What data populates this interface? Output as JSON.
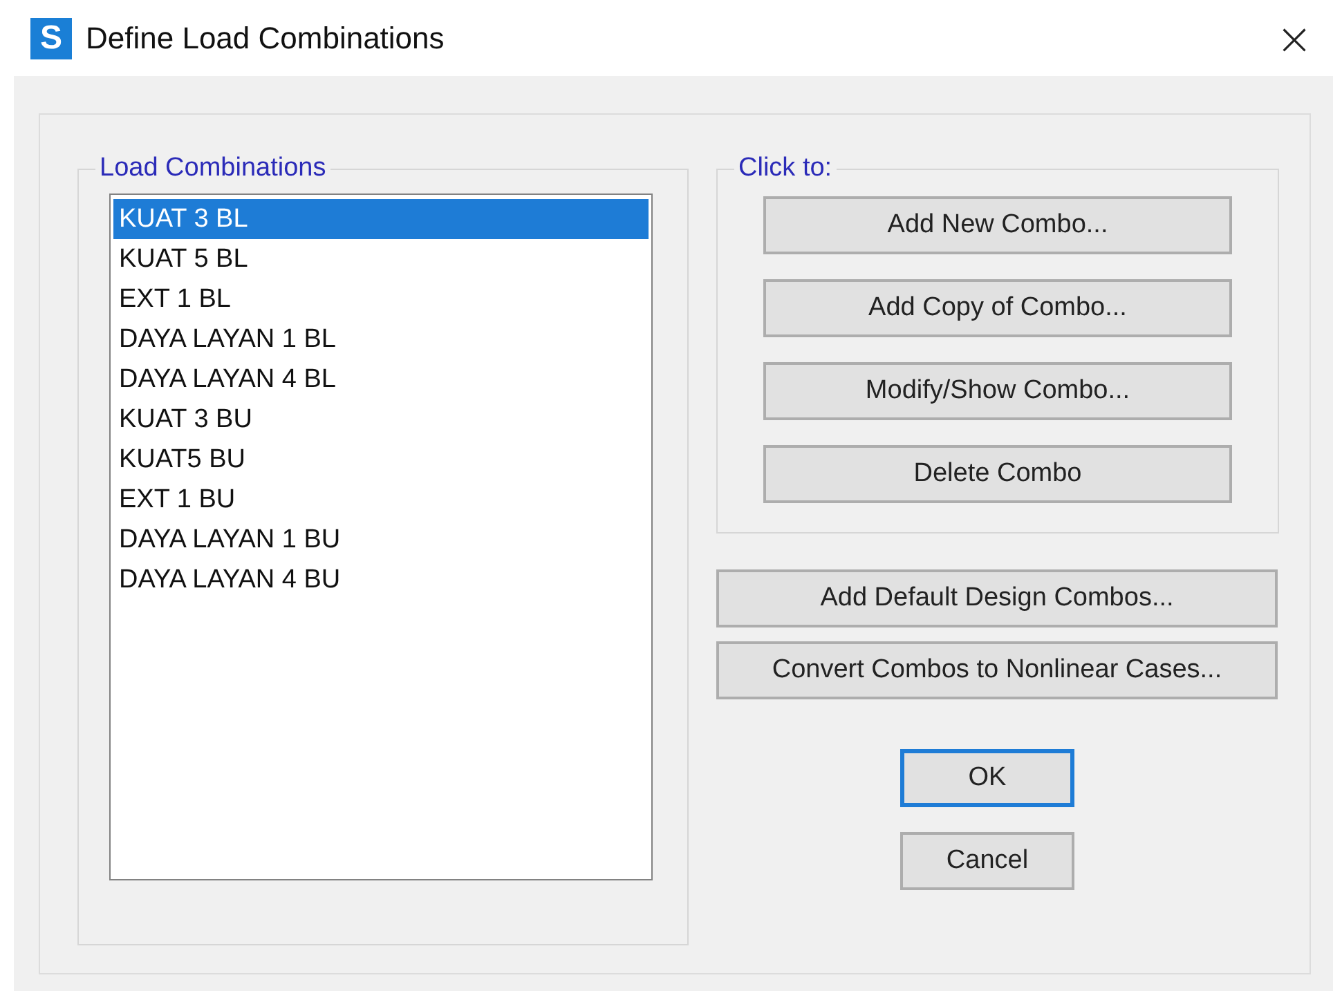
{
  "window": {
    "logo": "S",
    "title": "Define Load Combinations",
    "close": "×"
  },
  "load_combinations": {
    "label": "Load Combinations",
    "items": [
      {
        "name": "KUAT 3 BL",
        "selected": true
      },
      {
        "name": "KUAT 5 BL",
        "selected": false
      },
      {
        "name": "EXT 1 BL",
        "selected": false
      },
      {
        "name": "DAYA LAYAN 1 BL",
        "selected": false
      },
      {
        "name": "DAYA LAYAN 4 BL",
        "selected": false
      },
      {
        "name": "KUAT 3 BU",
        "selected": false
      },
      {
        "name": "KUAT5 BU",
        "selected": false
      },
      {
        "name": "EXT 1 BU",
        "selected": false
      },
      {
        "name": "DAYA LAYAN 1 BU",
        "selected": false
      },
      {
        "name": "DAYA LAYAN 4 BU",
        "selected": false
      }
    ]
  },
  "click_to": {
    "label": "Click to:",
    "buttons": [
      "Add New Combo...",
      "Add Copy of Combo...",
      "Modify/Show Combo...",
      "Delete Combo"
    ]
  },
  "extra_buttons": [
    "Add Default Design Combos...",
    "Convert Combos to Nonlinear Cases..."
  ],
  "dialog_buttons": [
    {
      "label": "OK",
      "default": true
    },
    {
      "label": "Cancel",
      "default": false
    }
  ]
}
